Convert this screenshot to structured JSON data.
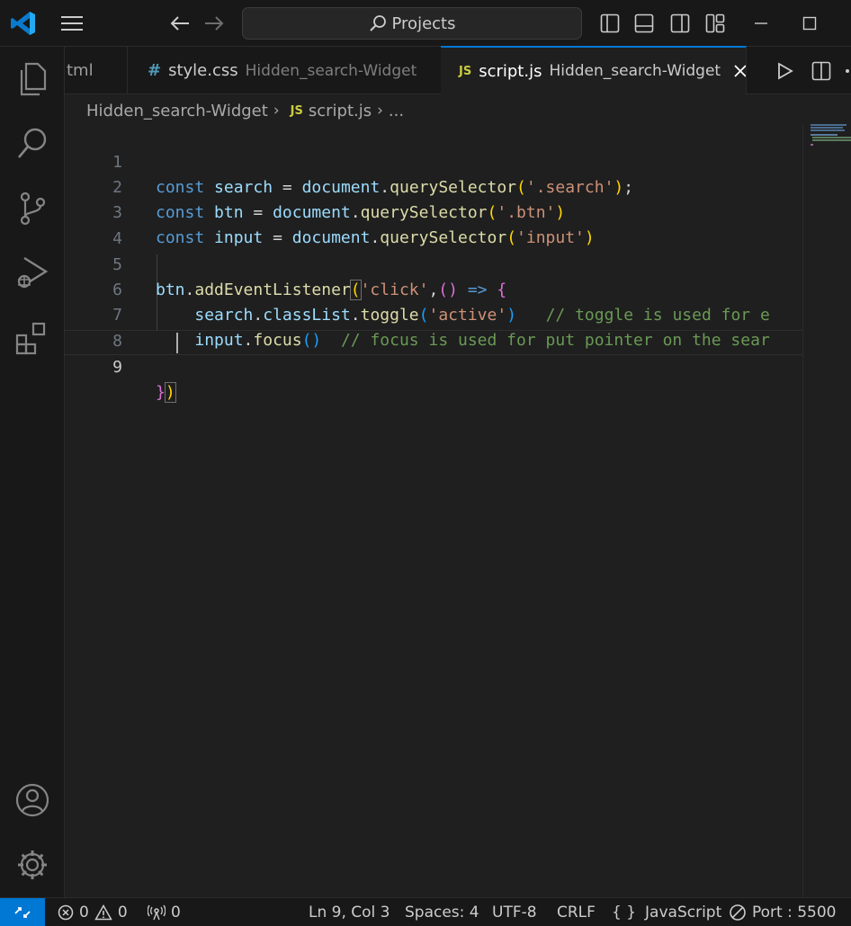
{
  "titlebar": {
    "search_label": "Projects"
  },
  "tabs": [
    {
      "name": "tml",
      "description": ""
    },
    {
      "name": "style.css",
      "description": "Hidden_search-Widget",
      "icon_text": "#"
    },
    {
      "name": "script.js",
      "description": "Hidden_search-Widget",
      "icon_text": "JS"
    }
  ],
  "breadcrumb": {
    "folder": "Hidden_search-Widget",
    "file_icon": "JS",
    "file": "script.js",
    "more": "..."
  },
  "editor": {
    "line_numbers": [
      "1",
      "2",
      "3",
      "4",
      "5",
      "6",
      "7",
      "8",
      "9"
    ],
    "current_line": "9"
  },
  "statusbar": {
    "errors": "0",
    "warnings": "0",
    "ports": "0",
    "position": "Ln 9, Col 3",
    "spaces": "Spaces: 4",
    "encoding": "UTF-8",
    "eol": "CRLF",
    "language_icon": "{ }",
    "language": "JavaScript",
    "port": "Port : 5500"
  },
  "colors": {
    "accent": "#0078d4",
    "editor_bg": "#1f1f1f",
    "chrome_bg": "#181818"
  }
}
